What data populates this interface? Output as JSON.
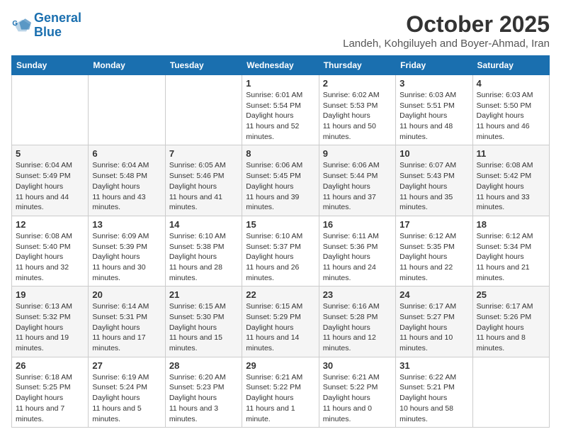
{
  "header": {
    "logo_line1": "General",
    "logo_line2": "Blue",
    "month": "October 2025",
    "location": "Landeh, Kohgiluyeh and Boyer-Ahmad, Iran"
  },
  "weekdays": [
    "Sunday",
    "Monday",
    "Tuesday",
    "Wednesday",
    "Thursday",
    "Friday",
    "Saturday"
  ],
  "weeks": [
    [
      null,
      null,
      null,
      {
        "day": 1,
        "sunrise": "6:01 AM",
        "sunset": "5:54 PM",
        "daylight": "11 hours and 52 minutes."
      },
      {
        "day": 2,
        "sunrise": "6:02 AM",
        "sunset": "5:53 PM",
        "daylight": "11 hours and 50 minutes."
      },
      {
        "day": 3,
        "sunrise": "6:03 AM",
        "sunset": "5:51 PM",
        "daylight": "11 hours and 48 minutes."
      },
      {
        "day": 4,
        "sunrise": "6:03 AM",
        "sunset": "5:50 PM",
        "daylight": "11 hours and 46 minutes."
      }
    ],
    [
      {
        "day": 5,
        "sunrise": "6:04 AM",
        "sunset": "5:49 PM",
        "daylight": "11 hours and 44 minutes."
      },
      {
        "day": 6,
        "sunrise": "6:04 AM",
        "sunset": "5:48 PM",
        "daylight": "11 hours and 43 minutes."
      },
      {
        "day": 7,
        "sunrise": "6:05 AM",
        "sunset": "5:46 PM",
        "daylight": "11 hours and 41 minutes."
      },
      {
        "day": 8,
        "sunrise": "6:06 AM",
        "sunset": "5:45 PM",
        "daylight": "11 hours and 39 minutes."
      },
      {
        "day": 9,
        "sunrise": "6:06 AM",
        "sunset": "5:44 PM",
        "daylight": "11 hours and 37 minutes."
      },
      {
        "day": 10,
        "sunrise": "6:07 AM",
        "sunset": "5:43 PM",
        "daylight": "11 hours and 35 minutes."
      },
      {
        "day": 11,
        "sunrise": "6:08 AM",
        "sunset": "5:42 PM",
        "daylight": "11 hours and 33 minutes."
      }
    ],
    [
      {
        "day": 12,
        "sunrise": "6:08 AM",
        "sunset": "5:40 PM",
        "daylight": "11 hours and 32 minutes."
      },
      {
        "day": 13,
        "sunrise": "6:09 AM",
        "sunset": "5:39 PM",
        "daylight": "11 hours and 30 minutes."
      },
      {
        "day": 14,
        "sunrise": "6:10 AM",
        "sunset": "5:38 PM",
        "daylight": "11 hours and 28 minutes."
      },
      {
        "day": 15,
        "sunrise": "6:10 AM",
        "sunset": "5:37 PM",
        "daylight": "11 hours and 26 minutes."
      },
      {
        "day": 16,
        "sunrise": "6:11 AM",
        "sunset": "5:36 PM",
        "daylight": "11 hours and 24 minutes."
      },
      {
        "day": 17,
        "sunrise": "6:12 AM",
        "sunset": "5:35 PM",
        "daylight": "11 hours and 22 minutes."
      },
      {
        "day": 18,
        "sunrise": "6:12 AM",
        "sunset": "5:34 PM",
        "daylight": "11 hours and 21 minutes."
      }
    ],
    [
      {
        "day": 19,
        "sunrise": "6:13 AM",
        "sunset": "5:32 PM",
        "daylight": "11 hours and 19 minutes."
      },
      {
        "day": 20,
        "sunrise": "6:14 AM",
        "sunset": "5:31 PM",
        "daylight": "11 hours and 17 minutes."
      },
      {
        "day": 21,
        "sunrise": "6:15 AM",
        "sunset": "5:30 PM",
        "daylight": "11 hours and 15 minutes."
      },
      {
        "day": 22,
        "sunrise": "6:15 AM",
        "sunset": "5:29 PM",
        "daylight": "11 hours and 14 minutes."
      },
      {
        "day": 23,
        "sunrise": "6:16 AM",
        "sunset": "5:28 PM",
        "daylight": "11 hours and 12 minutes."
      },
      {
        "day": 24,
        "sunrise": "6:17 AM",
        "sunset": "5:27 PM",
        "daylight": "11 hours and 10 minutes."
      },
      {
        "day": 25,
        "sunrise": "6:17 AM",
        "sunset": "5:26 PM",
        "daylight": "11 hours and 8 minutes."
      }
    ],
    [
      {
        "day": 26,
        "sunrise": "6:18 AM",
        "sunset": "5:25 PM",
        "daylight": "11 hours and 7 minutes."
      },
      {
        "day": 27,
        "sunrise": "6:19 AM",
        "sunset": "5:24 PM",
        "daylight": "11 hours and 5 minutes."
      },
      {
        "day": 28,
        "sunrise": "6:20 AM",
        "sunset": "5:23 PM",
        "daylight": "11 hours and 3 minutes."
      },
      {
        "day": 29,
        "sunrise": "6:21 AM",
        "sunset": "5:22 PM",
        "daylight": "11 hours and 1 minute."
      },
      {
        "day": 30,
        "sunrise": "6:21 AM",
        "sunset": "5:22 PM",
        "daylight": "11 hours and 0 minutes."
      },
      {
        "day": 31,
        "sunrise": "6:22 AM",
        "sunset": "5:21 PM",
        "daylight": "10 hours and 58 minutes."
      },
      null
    ]
  ]
}
